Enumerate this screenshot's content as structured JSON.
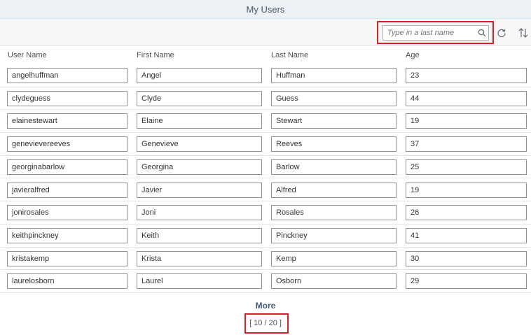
{
  "window": {
    "title": "My Users"
  },
  "toolbar": {
    "search": {
      "placeholder": "Type in a last name",
      "value": "",
      "icon": "search-icon"
    },
    "refresh_icon": "refresh-icon",
    "sort_icon": "sort-icon"
  },
  "table": {
    "columns": [
      "User Name",
      "First Name",
      "Last Name",
      "Age"
    ],
    "rows": [
      [
        "angelhuffman",
        "Angel",
        "Huffman",
        "23"
      ],
      [
        "clydeguess",
        "Clyde",
        "Guess",
        "44"
      ],
      [
        "elainestewart",
        "Elaine",
        "Stewart",
        "19"
      ],
      [
        "genevievereeves",
        "Genevieve",
        "Reeves",
        "37"
      ],
      [
        "georginabarlow",
        "Georgina",
        "Barlow",
        "25"
      ],
      [
        "javieralfred",
        "Javier",
        "Alfred",
        "19"
      ],
      [
        "jonirosales",
        "Joni",
        "Rosales",
        "26"
      ],
      [
        "keithpinckney",
        "Keith",
        "Pinckney",
        "41"
      ],
      [
        "kristakemp",
        "Krista",
        "Kemp",
        "30"
      ],
      [
        "laurelosborn",
        "Laurel",
        "Osborn",
        "29"
      ]
    ]
  },
  "footer": {
    "more_label": "More",
    "count_label": "[ 10 / 20 ]"
  },
  "colors": {
    "highlight": "#d52027",
    "title_bar": "#edf2f7",
    "more_text": "#3f5a7a"
  }
}
